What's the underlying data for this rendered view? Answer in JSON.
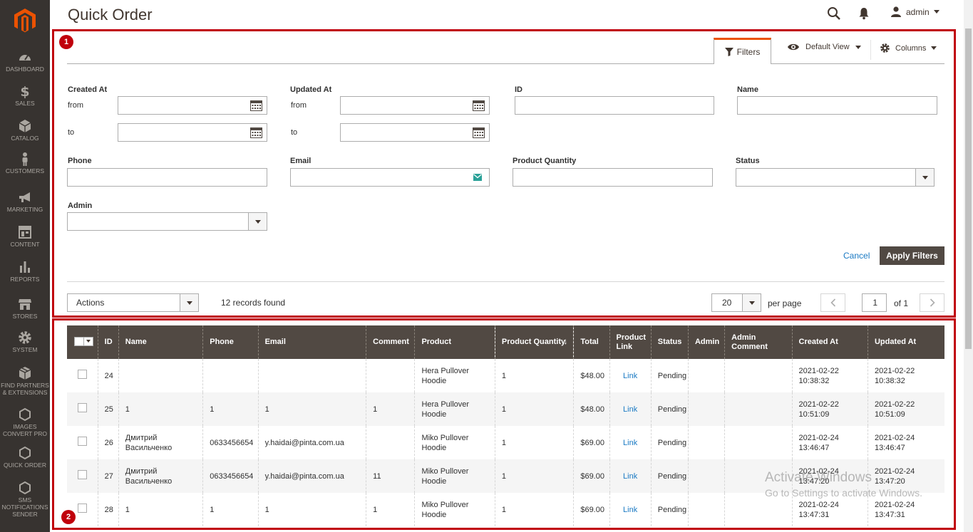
{
  "sidebar": {
    "items": [
      {
        "label": "DASHBOARD",
        "icon": "dashboard-icon"
      },
      {
        "label": "SALES",
        "icon": "dollar-icon"
      },
      {
        "label": "CATALOG",
        "icon": "cube-icon"
      },
      {
        "label": "CUSTOMERS",
        "icon": "person-icon"
      },
      {
        "label": "MARKETING",
        "icon": "megaphone-icon"
      },
      {
        "label": "CONTENT",
        "icon": "layout-icon"
      },
      {
        "label": "REPORTS",
        "icon": "bar-chart-icon"
      },
      {
        "label": "STORES",
        "icon": "store-icon"
      },
      {
        "label": "SYSTEM",
        "icon": "gear-icon"
      },
      {
        "label": "FIND PARTNERS & EXTENSIONS",
        "icon": "box-icon"
      },
      {
        "label": "IMAGES CONVERT PRO",
        "icon": "hexagon-icon"
      },
      {
        "label": "QUICK ORDER",
        "icon": "hexagon-icon"
      },
      {
        "label": "SMS NOTIFICATIONS SENDER",
        "icon": "hexagon-icon"
      }
    ]
  },
  "header": {
    "title": "Quick Order",
    "user": "admin"
  },
  "annotations": {
    "box1": "1",
    "box2": "2"
  },
  "toolbar": {
    "filters_label": "Filters",
    "view_label": "Default View",
    "columns_label": "Columns"
  },
  "filters": {
    "created_at": "Created At",
    "updated_at": "Updated At",
    "from": "from",
    "to": "to",
    "id": "ID",
    "name": "Name",
    "phone": "Phone",
    "email": "Email",
    "product_quantity": "Product Quantity",
    "status": "Status",
    "admin": "Admin",
    "cancel": "Cancel",
    "apply": "Apply Filters"
  },
  "listing": {
    "actions": "Actions",
    "records": "12 records found",
    "per_page_value": "20",
    "per_page_label": "per page",
    "page": "1",
    "of": "of 1"
  },
  "columns": [
    "ID",
    "Name",
    "Phone",
    "Email",
    "Comment",
    "Product",
    "Product Quantity",
    "Total",
    "Product Link",
    "Status",
    "Admin",
    "Admin Comment",
    "Created At",
    "Updated At"
  ],
  "rows": [
    {
      "id": "24",
      "name": "",
      "phone": "",
      "email": "",
      "comment": "",
      "product": "Hera Pullover Hoodie",
      "qty": "1",
      "total": "$48.00",
      "link": "Link",
      "status": "Pending",
      "admin": "",
      "admin_comment": "",
      "created": "2021-02-22 10:38:32",
      "updated": "2021-02-22 10:38:32"
    },
    {
      "id": "25",
      "name": "1",
      "phone": "1",
      "email": "1",
      "comment": "1",
      "product": "Hera Pullover Hoodie",
      "qty": "1",
      "total": "$48.00",
      "link": "Link",
      "status": "Pending",
      "admin": "",
      "admin_comment": "",
      "created": "2021-02-22 10:51:09",
      "updated": "2021-02-22 10:51:09"
    },
    {
      "id": "26",
      "name": "Дмитрий Васильченко",
      "phone": "0633456654",
      "email": "y.haidai@pinta.com.ua",
      "comment": "",
      "product": "Miko Pullover Hoodie",
      "qty": "1",
      "total": "$69.00",
      "link": "Link",
      "status": "Pending",
      "admin": "",
      "admin_comment": "",
      "created": "2021-02-24 13:46:47",
      "updated": "2021-02-24 13:46:47"
    },
    {
      "id": "27",
      "name": "Дмитрий Васильченко",
      "phone": "0633456654",
      "email": "y.haidai@pinta.com.ua",
      "comment": "11",
      "product": "Miko Pullover Hoodie",
      "qty": "1",
      "total": "$69.00",
      "link": "Link",
      "status": "Pending",
      "admin": "",
      "admin_comment": "",
      "created": "2021-02-24 13:47:20",
      "updated": "2021-02-24 13:47:20"
    },
    {
      "id": "28",
      "name": "1",
      "phone": "1",
      "email": "1",
      "comment": "1",
      "product": "Miko Pullover Hoodie",
      "qty": "1",
      "total": "$69.00",
      "link": "Link",
      "status": "Pending",
      "admin": "",
      "admin_comment": "",
      "created": "2021-02-24 13:47:31",
      "updated": "2021-02-24 13:47:31"
    }
  ],
  "watermark": {
    "line1": "Activate Windows",
    "line2": "Go to Settings to activate Windows."
  },
  "colors": {
    "sidebar": "#373330",
    "header_bg": "#514943",
    "accent": "#eb5202",
    "annotation": "#c0000c",
    "link": "#1979c3"
  }
}
